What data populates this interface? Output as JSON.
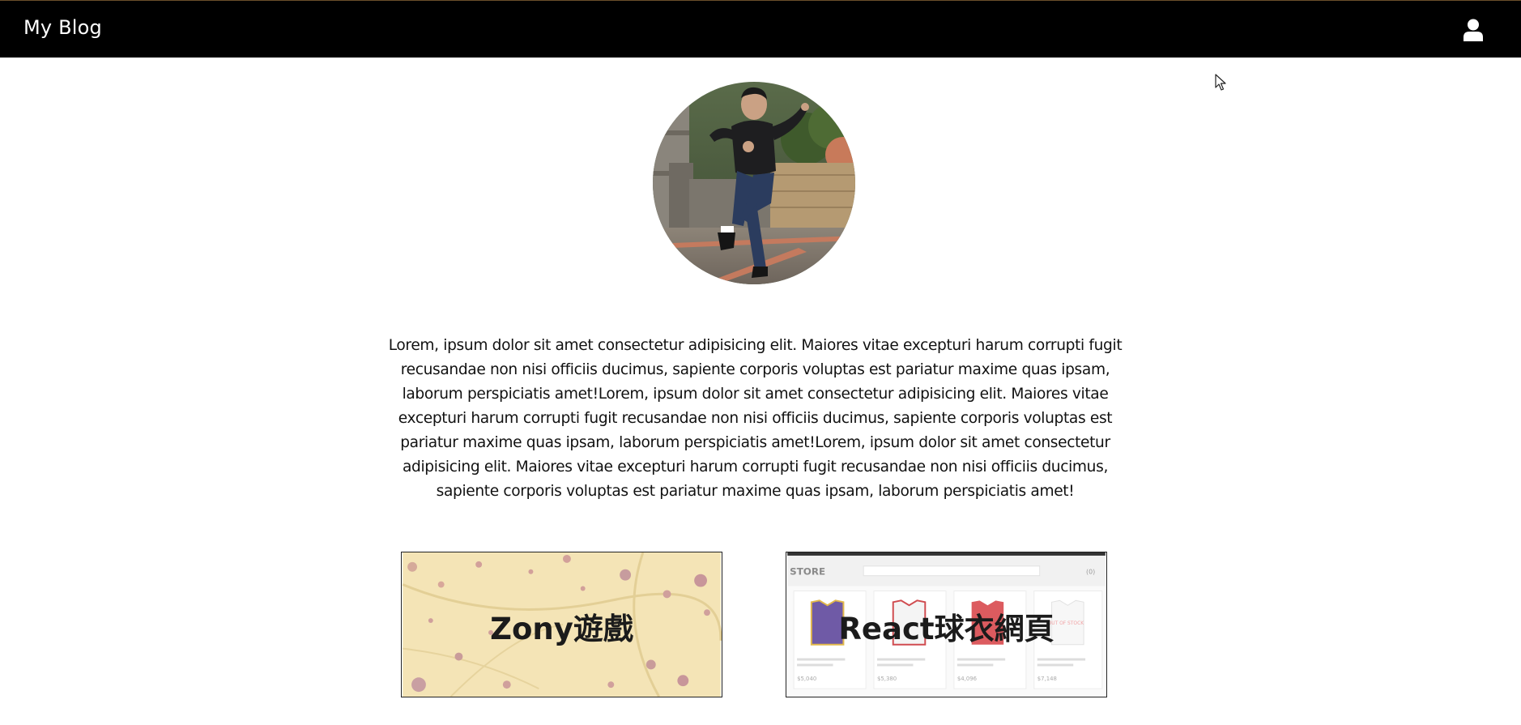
{
  "navbar": {
    "brand": "My Blog",
    "user_icon": "user-icon",
    "background": "#000000"
  },
  "profile": {
    "avatar_alt": "profile photo",
    "bio": "Lorem, ipsum dolor sit amet consectetur adipisicing elit. Maiores vitae excepturi harum corrupti fugit recusandae non nisi officiis ducimus, sapiente corporis voluptas est pariatur maxime quas ipsam, laborum perspiciatis amet!Lorem, ipsum dolor sit amet consectetur adipisicing elit. Maiores vitae excepturi harum corrupti fugit recusandae non nisi officiis ducimus, sapiente corporis voluptas est pariatur maxime quas ipsam, laborum perspiciatis amet!Lorem, ipsum dolor sit amet consectetur adipisicing elit. Maiores vitae excepturi harum corrupti fugit recusandae non nisi officiis ducimus, sapiente corporis voluptas est pariatur maxime quas ipsam, laborum perspiciatis amet!"
  },
  "projects": [
    {
      "title": "Zony遊戲"
    },
    {
      "title": "React球衣網頁"
    }
  ],
  "store_preview": {
    "store_label": "STORE",
    "out_of_stock": "OUT OF STOCK",
    "prices": [
      "$5,040",
      "$5,380",
      "$4,096",
      "$7,148"
    ],
    "cart_count": "(0)"
  }
}
